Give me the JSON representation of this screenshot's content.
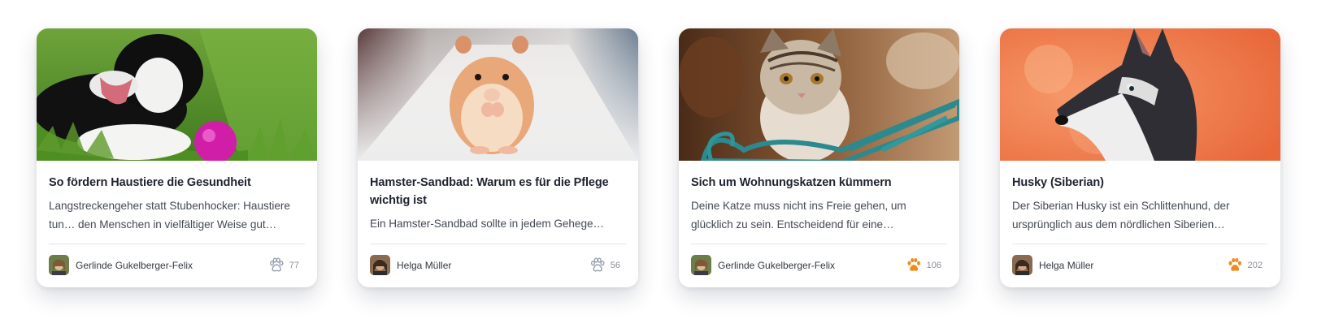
{
  "cards": [
    {
      "title": "So fördern Haustiere die Gesundheit",
      "description": "Langstreckengeher statt Stubenhocker: Haustiere tun… den Menschen in vielfältiger Weise gut…",
      "author": "Gerlinde Gukelberger-Felix",
      "likes": "77",
      "liked": false,
      "image": "border-collie-photo",
      "avatar": "woman-avatar"
    },
    {
      "title": "Hamster-Sandbad: Warum es für die Pflege wichtig ist",
      "description": "Ein Hamster-Sandbad sollte in jedem Gehege…",
      "author": "Helga Müller",
      "likes": "56",
      "liked": false,
      "image": "hamster-photo",
      "avatar": "woman-avatar"
    },
    {
      "title": "Sich um Wohnungskatzen kümmern",
      "description": "Deine Katze muss nicht ins Freie gehen, um glücklich zu sein. Entscheidend für eine…",
      "author": "Gerlinde Gukelberger-Felix",
      "likes": "106",
      "liked": true,
      "image": "tabby-kitten-photo",
      "avatar": "woman-avatar"
    },
    {
      "title": "Husky (Siberian)",
      "description": "Der Siberian Husky ist ein Schlittenhund, der ursprünglich aus dem nördlichen Siberien…",
      "author": "Helga Müller",
      "likes": "202",
      "liked": true,
      "image": "husky-photo",
      "avatar": "woman-avatar"
    }
  ],
  "colors": {
    "paw_liked": "#f08a1c",
    "paw_default": "#9aa3b2"
  }
}
